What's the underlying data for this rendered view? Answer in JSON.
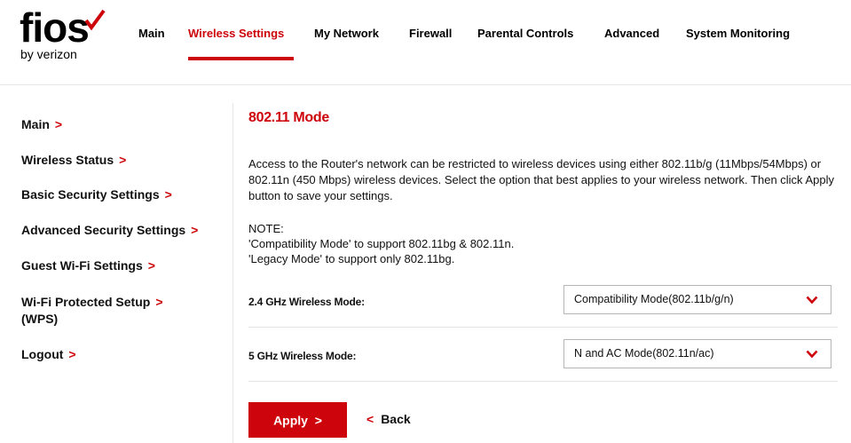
{
  "brand": {
    "logo_text": "fios",
    "logo_sub": "by verizon",
    "accent_color": "#cd040b"
  },
  "topnav": {
    "items": [
      {
        "label": "Main",
        "active": false
      },
      {
        "label": "Wireless Settings",
        "active": true
      },
      {
        "label": "My Network",
        "active": false
      },
      {
        "label": "Firewall",
        "active": false
      },
      {
        "label": "Parental Controls",
        "active": false
      },
      {
        "label": "Advanced",
        "active": false
      },
      {
        "label": "System Monitoring",
        "active": false
      }
    ]
  },
  "sidebar": {
    "items": [
      {
        "label": "Main",
        "chevron": ">"
      },
      {
        "label": "Wireless Status",
        "chevron": ">"
      },
      {
        "label": "Basic Security Settings",
        "chevron": ">"
      },
      {
        "label": "Advanced Security Settings",
        "chevron": ">"
      },
      {
        "label": "Guest Wi-Fi Settings",
        "chevron": ">"
      },
      {
        "label_line1": "Wi-Fi Protected Setup",
        "label_line2": "(WPS)",
        "chevron": ">"
      },
      {
        "label": "Logout",
        "chevron": ">"
      }
    ]
  },
  "main": {
    "title": "802.11 Mode",
    "description": "Access to the Router's network can be restricted to wireless devices using either 802.11b/g (11Mbps/54Mbps) or 802.11n (450 Mbps) wireless devices. Select the option that best applies to your wireless network. Then click Apply button to save your settings.",
    "note_heading": "NOTE:",
    "note_lines": [
      "'Compatibility Mode' to support 802.11bg & 802.11n.",
      "'Legacy Mode' to support only 802.11bg."
    ],
    "fields": [
      {
        "label": "2.4 GHz Wireless Mode:",
        "value": "Compatibility Mode(802.11b/g/n)"
      },
      {
        "label": "5 GHz Wireless Mode:",
        "value": "N and AC Mode(802.11n/ac)"
      }
    ],
    "apply_label": "Apply",
    "apply_chevron": ">",
    "back_label": "Back",
    "back_chevron": "<"
  }
}
